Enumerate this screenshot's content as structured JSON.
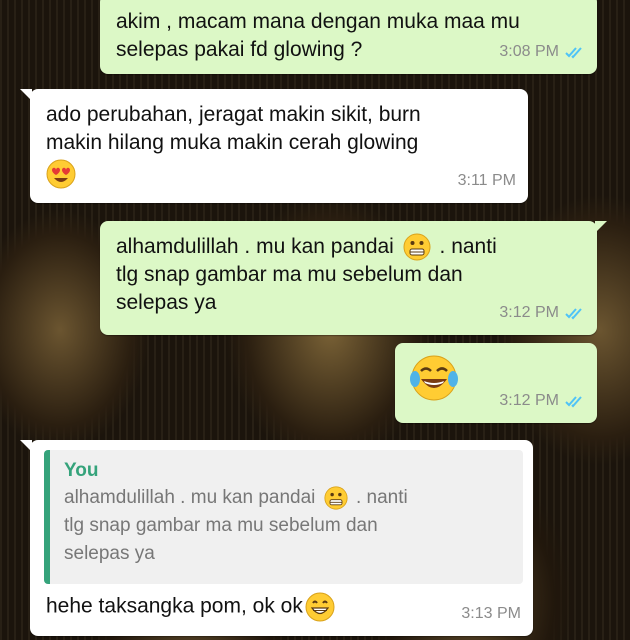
{
  "colors": {
    "outgoing_bubble": "#dcf8c6",
    "incoming_bubble": "#ffffff",
    "read_ticks": "#4fc3f7",
    "quote_accent": "#35a37b"
  },
  "messages": [
    {
      "direction": "outgoing",
      "lines": [
        "akim , macam mana dengan muka maa mu",
        "selepas pakai fd glowing ?"
      ],
      "time": "3:08 PM",
      "status_icon": "double-check-read-icon"
    },
    {
      "direction": "incoming",
      "lines": [
        "ado perubahan, jeragat makin sikit, burn",
        "makin hilang muka makin cerah glowing"
      ],
      "emoji": "heart-eyes-emoji",
      "time": "3:11 PM"
    },
    {
      "direction": "outgoing",
      "line1_before": "alhamdulillah . mu kan pandai",
      "line1_emoji": "grimacing-face-emoji",
      "line1_after": ". nanti",
      "lines": [
        "tlg snap gambar ma mu sebelum dan",
        "selepas ya"
      ],
      "time": "3:12 PM",
      "status_icon": "double-check-read-icon"
    },
    {
      "direction": "outgoing",
      "emoji": "tears-of-joy-emoji",
      "time": "3:12 PM",
      "status_icon": "double-check-read-icon"
    },
    {
      "direction": "incoming",
      "quote": {
        "author": "You",
        "line1_before": "alhamdulillah . mu kan pandai",
        "line1_emoji": "grimacing-face-emoji",
        "line1_after": ". nanti",
        "lines": [
          "tlg snap gambar ma mu sebelum dan",
          "selepas ya"
        ]
      },
      "text": "hehe taksangka pom, ok ok",
      "emoji": "grinning-face-emoji",
      "time": "3:13 PM"
    }
  ]
}
